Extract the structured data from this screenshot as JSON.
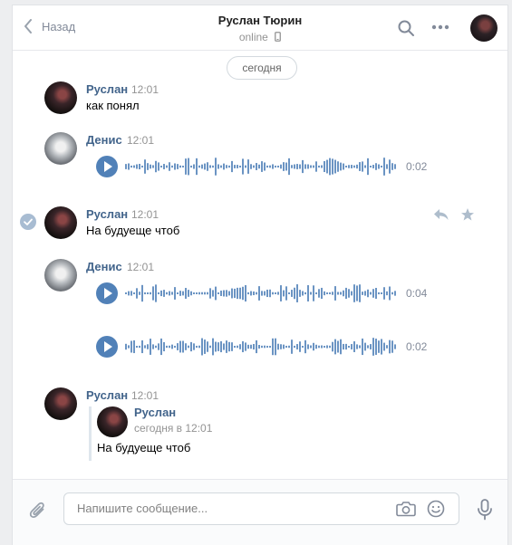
{
  "header": {
    "back_label": "Назад",
    "title": "Руслан Тюрин",
    "status": "online"
  },
  "date_divider": "сегодня",
  "messages": [
    {
      "author": "Руслан",
      "time": "12:01",
      "text": "как понял"
    },
    {
      "author": "Денис",
      "time": "12:01",
      "voice": [
        "0:02"
      ]
    },
    {
      "author": "Руслан",
      "time": "12:01",
      "text": "На будуеще чтоб",
      "selected": true
    },
    {
      "author": "Денис",
      "time": "12:01",
      "voice": [
        "0:04",
        "0:02"
      ]
    },
    {
      "author": "Руслан",
      "time": "12:01",
      "forwarded": {
        "author": "Руслан",
        "date": "сегодня в 12:01",
        "text": "На будуеще чтоб"
      }
    }
  ],
  "composer": {
    "placeholder": "Напишите сообщение..."
  },
  "icons": [
    "back-chevron-icon",
    "search-icon",
    "more-icon",
    "phone-icon",
    "play-icon",
    "check-icon",
    "reply-icon",
    "star-icon",
    "attach-icon",
    "camera-icon",
    "smile-icon",
    "mic-icon"
  ],
  "colors": {
    "accent": "#5181b8",
    "link": "#42648b",
    "muted": "#939393",
    "wave": "#5181b8"
  }
}
